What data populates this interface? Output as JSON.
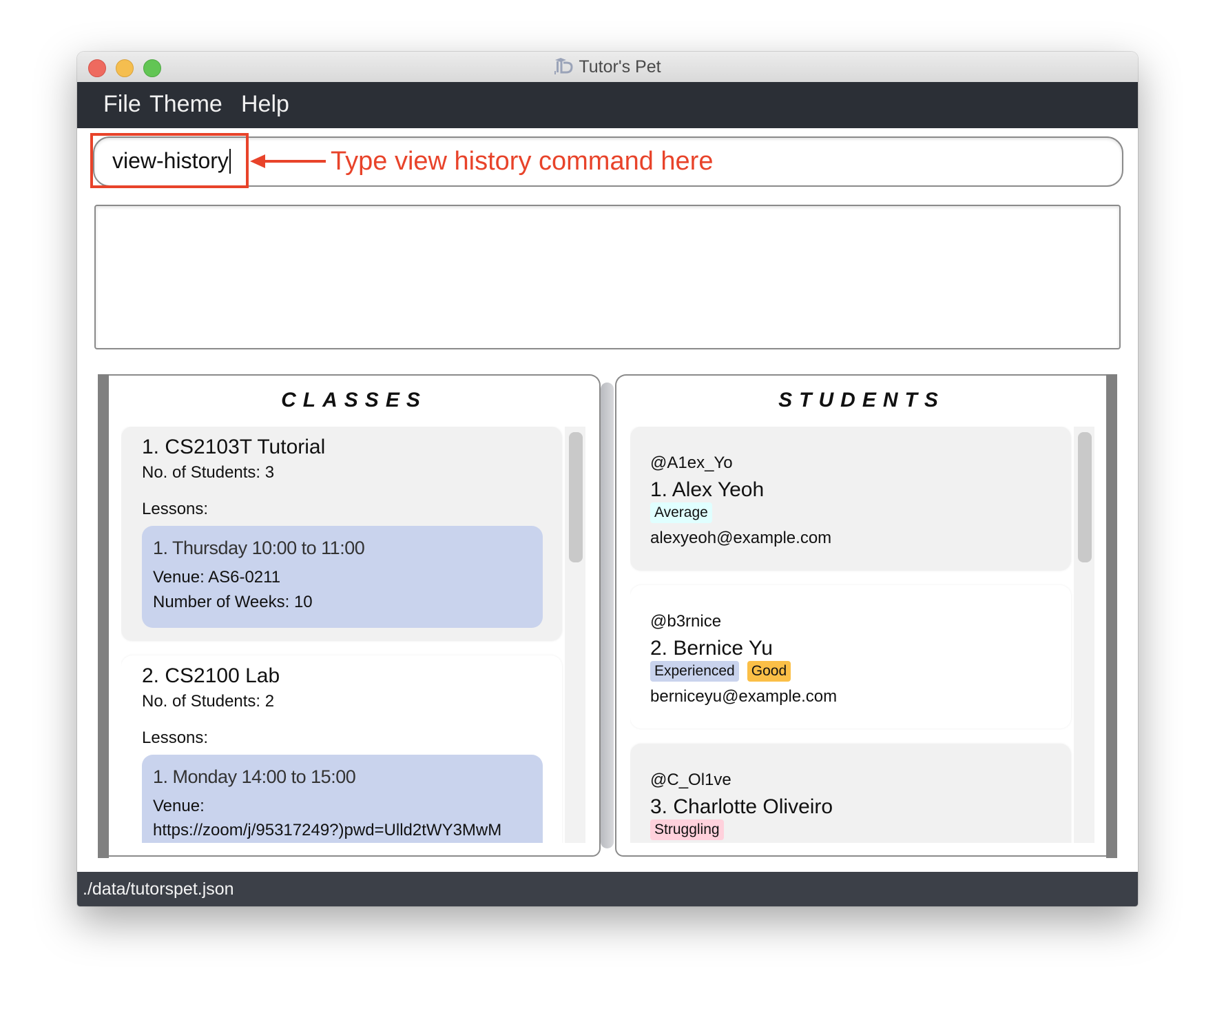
{
  "window": {
    "title": "Tutor's Pet",
    "traffic_lights": [
      "close",
      "minimize",
      "zoom"
    ]
  },
  "menu": {
    "items": [
      "File",
      "Theme",
      "Help"
    ]
  },
  "command": {
    "value": "view-history",
    "annotation": "Type view history command here",
    "annotation_color": "#e8432a"
  },
  "result": {
    "text": ""
  },
  "classes": {
    "title": "CLASSES",
    "items": [
      {
        "title": "1.  CS2103T Tutorial",
        "count": "No. of Students:  3",
        "lessons_label": "Lessons:",
        "lesson": {
          "time": "1. Thursday 10:00 to 11:00",
          "venue": "Venue: AS6-0211",
          "weeks": "Number of Weeks: 10"
        }
      },
      {
        "title": "2.  CS2100 Lab",
        "count": "No. of Students:  2",
        "lessons_label": "Lessons:",
        "lesson": {
          "time": "1. Monday 14:00 to 15:00",
          "venue": "Venue:",
          "venue_value": "https://zoom/j/95317249?)pwd=Ulld2tWY3MwM"
        }
      }
    ]
  },
  "students": {
    "title": "STUDENTS",
    "items": [
      {
        "handle": "@A1ex_Yo",
        "name": "1.  Alex Yeoh",
        "tags": [
          {
            "label": "Average",
            "color": "#e0ffff"
          }
        ],
        "email": "alexyeoh@example.com"
      },
      {
        "handle": "@b3rnice",
        "name": "2.  Bernice Yu",
        "tags": [
          {
            "label": "Experienced",
            "color": "#c9d3ed"
          },
          {
            "label": "Good",
            "color": "#fbbf47"
          }
        ],
        "email": "berniceyu@example.com"
      },
      {
        "handle": "@C_Ol1ve",
        "name": "3.  Charlotte Oliveiro",
        "tags": [
          {
            "label": "Struggling",
            "color": "#ffd1dc"
          }
        ],
        "email": ""
      }
    ]
  },
  "status": {
    "path": "./data/tutorspet.json"
  }
}
